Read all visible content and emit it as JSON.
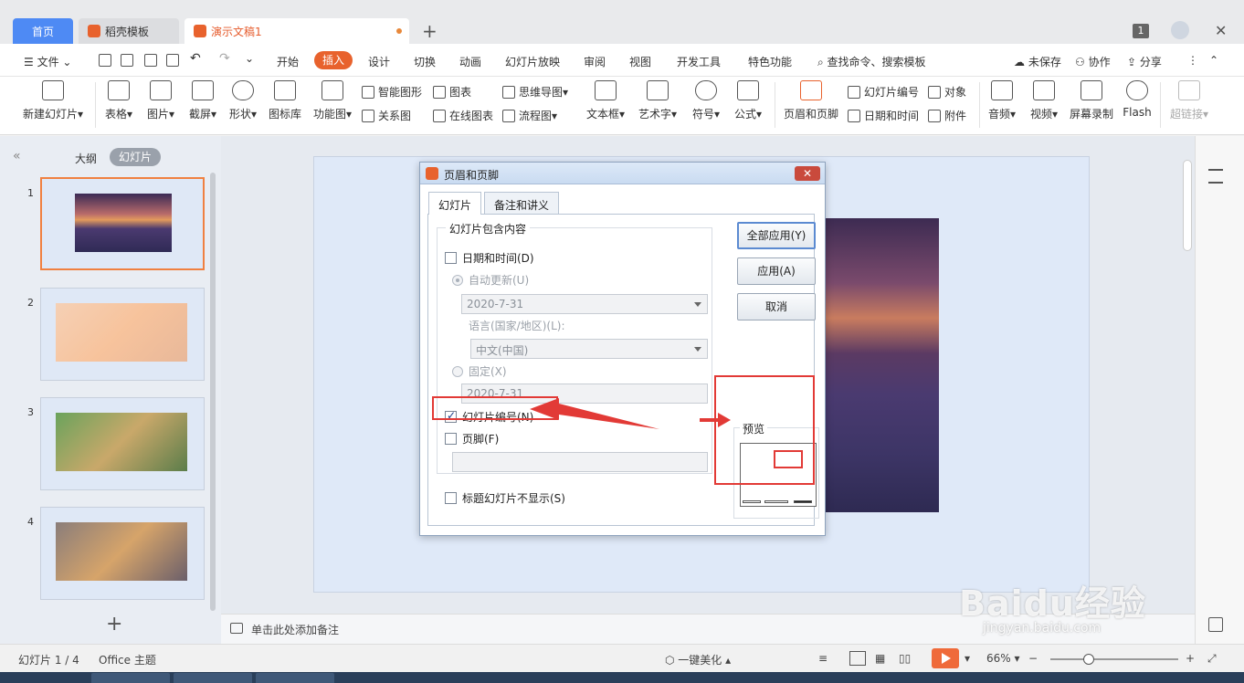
{
  "tabs": {
    "home": "首页",
    "template": "稻壳模板",
    "document": "演示文稿1",
    "page_badge": "1"
  },
  "menu": {
    "file": "文件",
    "items": [
      "开始",
      "插入",
      "设计",
      "切换",
      "动画",
      "幻灯片放映",
      "审阅",
      "视图",
      "开发工具",
      "特色功能"
    ],
    "search": "查找命令、搜索模板",
    "unsaved": "未保存",
    "collab": "协作",
    "share": "分享"
  },
  "ribbon": {
    "new_slide": "新建幻灯片",
    "table": "表格",
    "picture": "图片",
    "screenshot": "截屏",
    "shape": "形状",
    "icon_lib": "图标库",
    "func_chart": "功能图",
    "smart_shape": "智能图形",
    "chart": "图表",
    "relation": "关系图",
    "online_chart": "在线图表",
    "mindmap": "思维导图",
    "flowchart": "流程图",
    "textbox": "文本框",
    "wordart": "艺术字",
    "symbol": "符号",
    "formula": "公式",
    "header_footer": "页眉和页脚",
    "slide_number": "幻灯片编号",
    "object": "对象",
    "datetime": "日期和时间",
    "attachment": "附件",
    "audio": "音频",
    "video": "视频",
    "screen_record": "屏幕录制",
    "flash": "Flash",
    "hyperlink": "超链接"
  },
  "left_panel": {
    "outline": "大纲",
    "slides": "幻灯片",
    "numbers": [
      "1",
      "2",
      "3",
      "4"
    ],
    "add": "+"
  },
  "notes": {
    "placeholder": "单击此处添加备注"
  },
  "dialog": {
    "title": "页眉和页脚",
    "close": "✕",
    "tab_slide": "幻灯片",
    "tab_notes": "备注和讲义",
    "group_label": "幻灯片包含内容",
    "date_time": "日期和时间(D)",
    "auto_update": "自动更新(U)",
    "date_value": "2020-7-31",
    "language_label": "语言(国家/地区)(L):",
    "language_value": "中文(中国)",
    "fixed": "固定(X)",
    "fixed_value": "2020-7-31",
    "slide_number": "幻灯片编号(N)",
    "footer": "页脚(F)",
    "hide_title": "标题幻灯片不显示(S)",
    "apply_all": "全部应用(Y)",
    "apply": "应用(A)",
    "cancel": "取消",
    "preview": "预览"
  },
  "status": {
    "slide_info": "幻灯片 1 / 4",
    "theme": "Office 主题",
    "beautify": "一键美化",
    "zoom": "66%",
    "zoom_fraction": 0.3
  },
  "watermark": {
    "text": "Baidu经验",
    "url": "jingyan.baidu.com"
  },
  "colors": {
    "accent": "#e8622d",
    "annotation": "#e23a36",
    "home_tab": "#4e8af4"
  }
}
